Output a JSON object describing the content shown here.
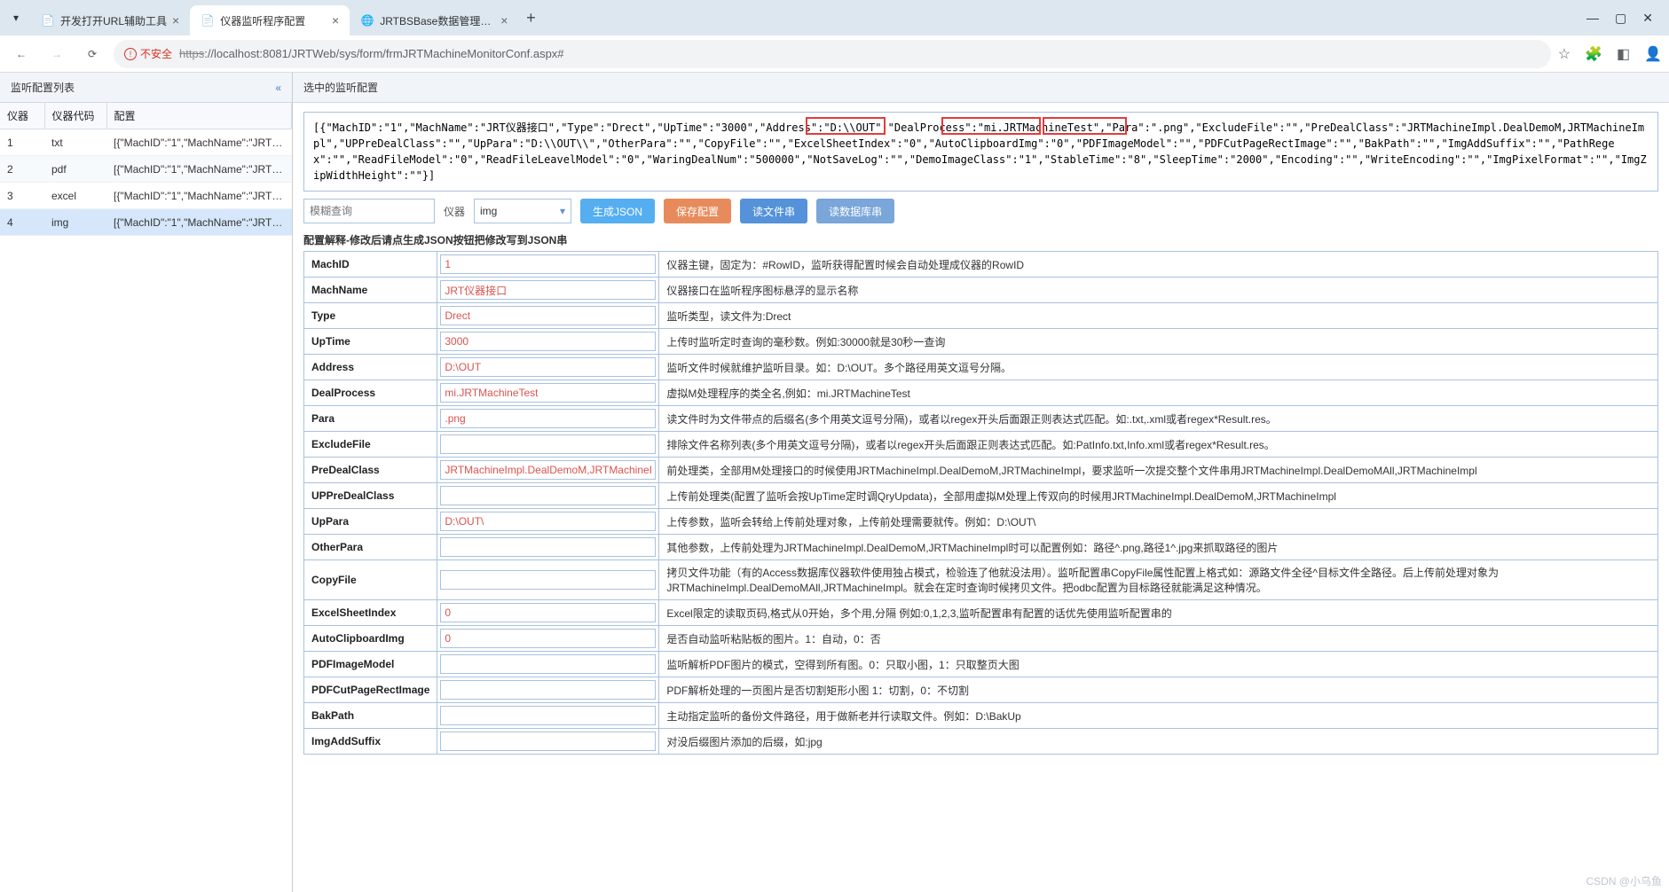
{
  "browser": {
    "tabs": [
      {
        "title": "开发打开URL辅助工具",
        "icon": "doc"
      },
      {
        "title": "仪器监听程序配置",
        "icon": "doc",
        "active": true
      },
      {
        "title": "JRTBSBase数据管理工具",
        "icon": "globe"
      }
    ],
    "unsafe_label": "不安全",
    "url_https": "https",
    "url_rest": "://localhost:8081/JRTWeb/sys/form/frmJRTMachineMonitorConf.aspx#"
  },
  "left": {
    "panel_title": "监听配置列表",
    "columns": {
      "c1": "仪器",
      "c2": "仪器代码",
      "c3": "配置"
    },
    "rows": [
      {
        "idx": "1",
        "code": "txt",
        "cfg": "[{\"MachID\":\"1\",\"MachName\":\"JRT仪…"
      },
      {
        "idx": "2",
        "code": "pdf",
        "cfg": "[{\"MachID\":\"1\",\"MachName\":\"JRT仪…"
      },
      {
        "idx": "3",
        "code": "excel",
        "cfg": "[{\"MachID\":\"1\",\"MachName\":\"JRT仪…"
      },
      {
        "idx": "4",
        "code": "img",
        "cfg": "[{\"MachID\":\"1\",\"MachName\":\"JRT仪…",
        "selected": true
      }
    ]
  },
  "right": {
    "panel_title": "选中的监听配置",
    "json_text": "[{\"MachID\":\"1\",\"MachName\":\"JRT仪器接口\",\"Type\":\"Drect\",\"UpTime\":\"3000\",\"Address\":\"D:\\\\OUT\",\"DealProcess\":\"mi.JRTMachineTest\",\"Para\":\".png\",\"ExcludeFile\":\"\",\"PreDealClass\":\"JRTMachineImpl.DealDemoM,JRTMachineImpl\",\"UPPreDealClass\":\"\",\"UpPara\":\"D:\\\\OUT\\\\\",\"OtherPara\":\"\",\"CopyFile\":\"\",\"ExcelSheetIndex\":\"0\",\"AutoClipboardImg\":\"0\",\"PDFImageModel\":\"\",\"PDFCutPageRectImage\":\"\",\"BakPath\":\"\",\"ImgAddSuffix\":\"\",\"PathRegex\":\"\",\"ReadFileModel\":\"0\",\"ReadFileLeavelModel\":\"0\",\"WaringDealNum\":\"500000\",\"NotSaveLog\":\"\",\"DemoImageClass\":\"1\",\"StableTime\":\"8\",\"SleepTime\":\"2000\",\"Encoding\":\"\",\"WriteEncoding\":\"\",\"ImgPixelFormat\":\"\",\"ImgZipWidthHeight\":\"\"}]",
    "controls": {
      "search_ph": "模糊查询",
      "combo_label": "仪器",
      "combo_value": "img",
      "btn_gen": "生成JSON",
      "btn_save": "保存配置",
      "btn_readfile": "读文件串",
      "btn_readdb": "读数据库串"
    },
    "section_title": "配置解释-修改后请点生成JSON按钮把修改写到JSON串",
    "rows": [
      {
        "label": "MachID",
        "value": "1",
        "red": true,
        "desc": "仪器主键，固定为：#RowID，监听获得配置时候会自动处理成仪器的RowID"
      },
      {
        "label": "MachName",
        "value": "JRT仪器接口",
        "red": true,
        "desc": "仪器接口在监听程序图标悬浮的显示名称"
      },
      {
        "label": "Type",
        "value": "Drect",
        "red": true,
        "desc": "监听类型，读文件为:Drect"
      },
      {
        "label": "UpTime",
        "value": "3000",
        "red": true,
        "desc": "上传时监听定时查询的毫秒数。例如:30000就是30秒一查询"
      },
      {
        "label": "Address",
        "value": "D:\\OUT",
        "red": true,
        "desc": "监听文件时候就维护监听目录。如：D:\\OUT。多个路径用英文逗号分隔。"
      },
      {
        "label": "DealProcess",
        "value": "mi.JRTMachineTest",
        "red": true,
        "desc": "虚拟M处理程序的类全名,例如：mi.JRTMachineTest"
      },
      {
        "label": "Para",
        "value": ".png",
        "red": true,
        "desc": "读文件时为文件带点的后缀名(多个用英文逗号分隔)，或者以regex开头后面跟正则表达式匹配。如:.txt,.xml或者regex*Result.res。"
      },
      {
        "label": "ExcludeFile",
        "value": "",
        "red": false,
        "desc": "排除文件名称列表(多个用英文逗号分隔)，或者以regex开头后面跟正则表达式匹配。如:PatInfo.txt,Info.xml或者regex*Result.res。"
      },
      {
        "label": "PreDealClass",
        "value": "JRTMachineImpl.DealDemoM,JRTMachineImpl",
        "red": true,
        "desc": "前处理类，全部用M处理接口的时候使用JRTMachineImpl.DealDemoM,JRTMachineImpl，要求监听一次提交整个文件串用JRTMachineImpl.DealDemoMAll,JRTMachineImpl"
      },
      {
        "label": "UPPreDealClass",
        "value": "",
        "red": false,
        "desc": "上传前处理类(配置了监听会按UpTime定时调QryUpdata)，全部用虚拟M处理上传双向的时候用JRTMachineImpl.DealDemoM,JRTMachineImpl"
      },
      {
        "label": "UpPara",
        "value": "D:\\OUT\\",
        "red": true,
        "desc": "上传参数，监听会转给上传前处理对象，上传前处理需要就传。例如：D:\\OUT\\"
      },
      {
        "label": "OtherPara",
        "value": "",
        "red": false,
        "desc": "其他参数，上传前处理为JRTMachineImpl.DealDemoM,JRTMachineImpl时可以配置例如：路径^.png,路径1^.jpg来抓取路径的图片"
      },
      {
        "label": "CopyFile",
        "value": "",
        "red": false,
        "desc": "拷贝文件功能（有的Access数据库仪器软件使用独占模式，检验连了他就没法用）。监听配置串CopyFile属性配置上格式如：源路文件全径^目标文件全路径。后上传前处理对象为JRTMachineImpl.DealDemoMAll,JRTMachineImpl。就会在定时查询时候拷贝文件。把odbc配置为目标路径就能满足这种情况。"
      },
      {
        "label": "ExcelSheetIndex",
        "value": "0",
        "red": true,
        "desc": "Excel限定的读取页码,格式从0开始，多个用,分隔 例如:0,1,2,3,监听配置串有配置的话优先使用监听配置串的"
      },
      {
        "label": "AutoClipboardImg",
        "value": "0",
        "red": true,
        "desc": "是否自动监听粘贴板的图片。1：自动，0：否"
      },
      {
        "label": "PDFImageModel",
        "value": "",
        "red": false,
        "desc": "监听解析PDF图片的模式，空得到所有图。0：只取小图，1：只取整页大图"
      },
      {
        "label": "PDFCutPageRectImage",
        "value": "",
        "red": false,
        "desc": "PDF解析处理的一页图片是否切割矩形小图 1：切割，0：不切割"
      },
      {
        "label": "BakPath",
        "value": "",
        "red": false,
        "desc": "主动指定监听的备份文件路径，用于做新老并行读取文件。例如：D:\\BakUp"
      },
      {
        "label": "ImgAddSuffix",
        "value": "",
        "red": false,
        "desc": "对没后缀图片添加的后缀，如:jpg"
      }
    ]
  },
  "watermark": "CSDN @小乌鱼"
}
